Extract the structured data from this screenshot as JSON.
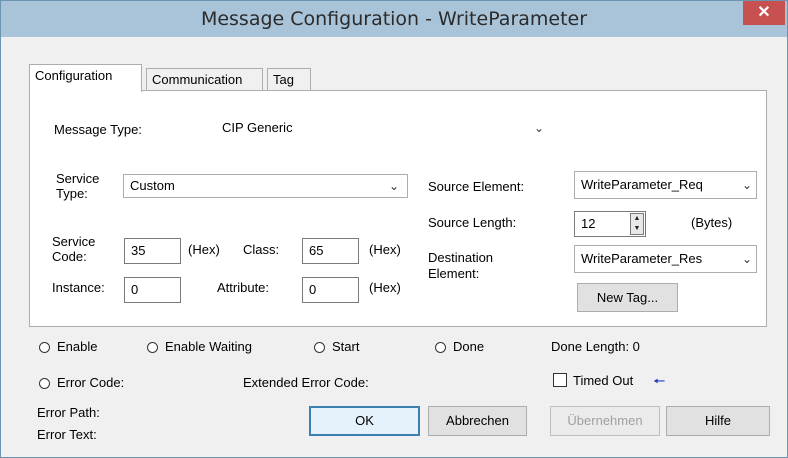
{
  "window": {
    "title": "Message Configuration - WriteParameter",
    "close_glyph": "✕"
  },
  "tabs": [
    {
      "label": "Configuration"
    },
    {
      "label": "Communication"
    },
    {
      "label": "Tag"
    }
  ],
  "config": {
    "message_type": {
      "label": "Message Type:",
      "value": "CIP Generic"
    },
    "service_type": {
      "label_line1": "Service",
      "label_line2": "Type:",
      "value": "Custom"
    },
    "service_code": {
      "label_line1": "Service",
      "label_line2": "Code:",
      "value": "35",
      "unit": "(Hex)"
    },
    "class": {
      "label": "Class:",
      "value": "65",
      "unit": "(Hex)"
    },
    "instance": {
      "label": "Instance:",
      "value": "0"
    },
    "attribute": {
      "label": "Attribute:",
      "value": "0",
      "unit": "(Hex)"
    },
    "source_element": {
      "label": "Source Element:",
      "value": "WriteParameter_Req"
    },
    "source_length": {
      "label": "Source Length:",
      "value": "12",
      "unit": "(Bytes)"
    },
    "destination_element": {
      "label_line1": "Destination",
      "label_line2": "Element:",
      "value": "WriteParameter_Res"
    },
    "new_tag_button": "New Tag..."
  },
  "status": {
    "enable": "Enable",
    "enable_waiting": "Enable Waiting",
    "start": "Start",
    "done": "Done",
    "done_length": "Done Length: 0",
    "error_code": "Error Code:",
    "extended_error_code": "Extended Error Code:",
    "timed_out": "Timed Out",
    "timed_out_arrow": "🠔",
    "error_path": "Error Path:",
    "error_text": "Error Text:"
  },
  "buttons": {
    "ok": "OK",
    "cancel": "Abbrechen",
    "apply": "Übernehmen",
    "help": "Hilfe"
  },
  "colors": {
    "titlebar": "#a9c4d9",
    "close": "#c75050",
    "arrow": "#1f3fbf"
  }
}
